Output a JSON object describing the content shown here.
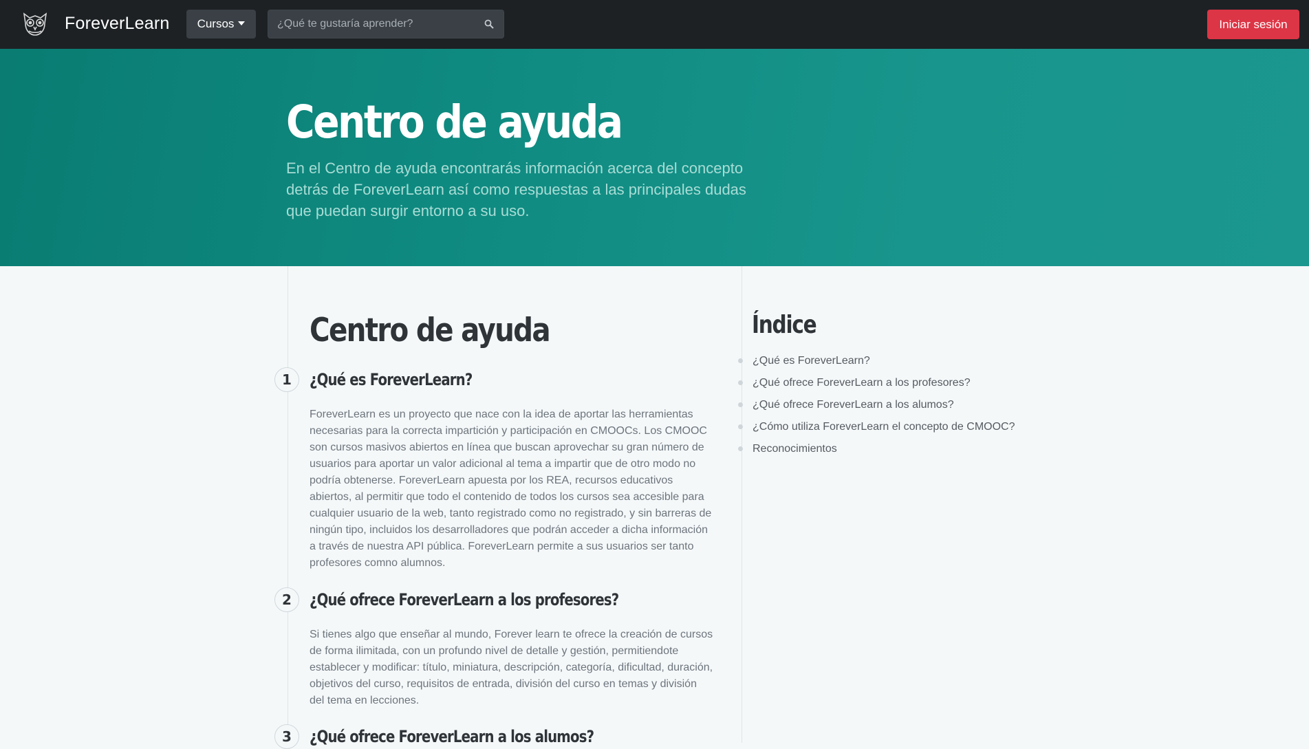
{
  "navbar": {
    "brand": "ForeverLearn",
    "courses_menu": "Cursos",
    "search_placeholder": "¿Qué te gustaría aprender?",
    "login_button": "Iniciar sesión",
    "icons": {
      "logo": "owl-logo-icon",
      "search": "search-icon",
      "dropdown": "caret-down-icon"
    }
  },
  "hero": {
    "title": "Centro de ayuda",
    "description": "En el Centro de ayuda encontrarás información acerca del concepto detrás de ForeverLearn así como respuestas a las principales dudas que puedan surgir entorno a su uso."
  },
  "main": {
    "heading": "Centro de ayuda",
    "sections": [
      {
        "number": "1",
        "title": "¿Qué es ForeverLearn?",
        "body": "ForeverLearn es un proyecto que nace con la idea de aportar las herramientas necesarias para la correcta impartición y participación en CMOOCs. Los CMOOC son cursos masivos abiertos en línea que buscan aprovechar su gran número de usuarios para aportar un valor adicional al tema a impartir que de otro modo no podría obtenerse. ForeverLearn apuesta por los REA, recursos educativos abiertos, al permitir que todo el contenido de todos los cursos sea accesible para cualquier usuario de la web, tanto registrado como no registrado, y sin barreras de ningún tipo, incluidos los desarrolladores que podrán acceder a dicha información a través de nuestra API pública. ForeverLearn permite a sus usuarios ser tanto profesores comno alumnos."
      },
      {
        "number": "2",
        "title": "¿Qué ofrece ForeverLearn a los profesores?",
        "body": "Si tienes algo que enseñar al mundo, Forever learn te ofrece la creación de cursos de forma ilimitada, con un profundo nivel de detalle y gestión, permitiendote establecer y modificar: título, miniatura, descripción, categoría, dificultad, duración, objetivos del curso, requisitos de entrada, división del curso en temas y división del tema en lecciones."
      },
      {
        "number": "3",
        "title": "¿Qué ofrece ForeverLearn a los alumos?",
        "body": ""
      }
    ]
  },
  "sidebar": {
    "title": "Índice",
    "items": [
      "¿Qué es ForeverLearn?",
      "¿Qué ofrece ForeverLearn a los profesores?",
      "¿Qué ofrece ForeverLearn a los alumos?",
      "¿Cómo utiliza ForeverLearn el concepto de CMOOC?",
      "Reconocimientos"
    ]
  },
  "colors": {
    "navbar": "#1d2124",
    "hero": "#0f8a80",
    "login": "#dc3545",
    "background": "#f5f8f9"
  }
}
